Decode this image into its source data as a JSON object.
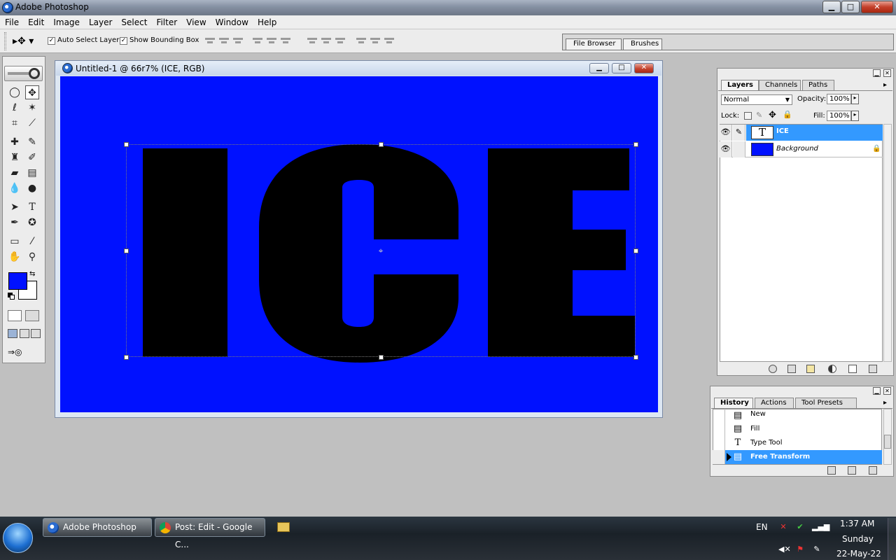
{
  "window": {
    "title": "Adobe Photoshop",
    "controls": {
      "minimize": "▁",
      "maximize": "□",
      "close": "✕"
    }
  },
  "menu": [
    "File",
    "Edit",
    "Image",
    "Layer",
    "Select",
    "Filter",
    "View",
    "Window",
    "Help"
  ],
  "options": {
    "auto_select_layer": "Auto Select Layer",
    "auto_select_checked": "✓",
    "show_bounding_box": "Show Bounding Box",
    "show_bounding_checked": "✓",
    "well_tabs": [
      "File Browser",
      "Brushes"
    ]
  },
  "toolbox": {
    "foreground_color": "#0011ff",
    "background_color": "#ffffff"
  },
  "document": {
    "title": "Untitled-1 @ 66r7% (ICE, RGB)",
    "canvas_color": "#0011ff",
    "text_color": "#000000"
  },
  "layers": {
    "tabs": [
      "Layers",
      "Channels",
      "Paths"
    ],
    "blend_mode": "Normal",
    "opacity_label": "Opacity:",
    "opacity": "100%",
    "lock_label": "Lock:",
    "fill_label": "Fill:",
    "fill": "100%",
    "items": [
      {
        "name": "ICE",
        "thumb": "T"
      },
      {
        "name": "Background"
      }
    ]
  },
  "history": {
    "tabs": [
      "History",
      "Actions",
      "Tool Presets"
    ],
    "items": [
      "New",
      "Fill",
      "Type Tool",
      "Free Transform"
    ]
  },
  "taskbar": {
    "buttons": [
      "Adobe Photoshop",
      "Post: Edit - Google C..."
    ],
    "language": "EN",
    "time": "1:37 AM",
    "day": "Sunday",
    "date": "22-May-22"
  }
}
